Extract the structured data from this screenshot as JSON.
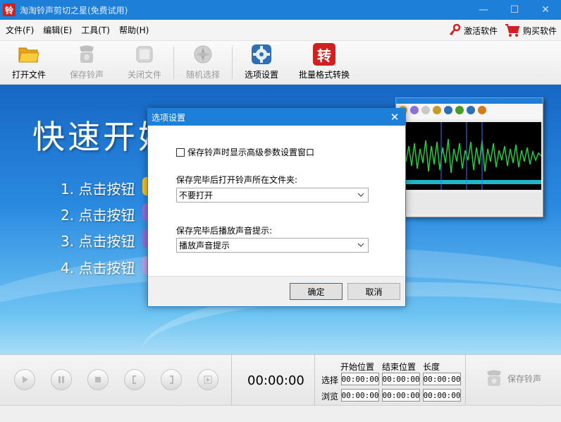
{
  "window": {
    "title": "淘淘铃声剪切之星(免费试用)",
    "app_icon_char": "铃",
    "controls": {
      "minimize": "—",
      "maximize": "☐",
      "close": "✕"
    }
  },
  "menu": {
    "items": [
      "文件(F)",
      "编辑(E)",
      "工具(T)",
      "帮助(H)"
    ],
    "activate": "激活软件",
    "buy": "购买软件"
  },
  "toolbar": {
    "items": [
      {
        "label": "打开文件",
        "icon": "folder-icon",
        "enabled": true
      },
      {
        "label": "保存铃声",
        "icon": "phone-save-icon",
        "enabled": false
      },
      {
        "label": "关闭文件",
        "icon": "close-file-icon",
        "enabled": false
      },
      {
        "label": "随机选择",
        "icon": "random-icon",
        "enabled": false
      },
      {
        "label": "选项设置",
        "icon": "settings-icon",
        "enabled": true
      },
      {
        "label": "批量格式转换",
        "icon": "convert-icon",
        "enabled": true,
        "icon_text": "转"
      }
    ]
  },
  "main": {
    "headline": "快速开始",
    "steps": [
      {
        "num": "1.",
        "text": "点击按钮"
      },
      {
        "num": "2.",
        "text": "点击按钮"
      },
      {
        "num": "3.",
        "text": "点击按钮"
      },
      {
        "num": "4.",
        "text": "点击按钮"
      }
    ]
  },
  "dialog": {
    "title": "选项设置",
    "close": "✕",
    "checkbox_label": "保存铃声时显示高级参数设置窗口",
    "checkbox_checked": false,
    "folder_label": "保存完毕后打开铃声所在文件夹:",
    "folder_value": "不要打开",
    "sound_label": "保存完毕后播放声音提示:",
    "sound_value": "播放声音提示",
    "ok": "确定",
    "cancel": "取消"
  },
  "controls": {
    "time": "00:00:00",
    "headers": [
      "开始位置",
      "结束位置",
      "长度"
    ],
    "row_select": "选择",
    "row_browse": "浏览",
    "select_values": [
      "00:00:00",
      "00:00:00",
      "00:00:00"
    ],
    "browse_values": [
      "00:00:00",
      "00:00:00",
      "00:00:00"
    ],
    "save_label": "保存铃声"
  },
  "colors": {
    "accent": "#1e7fd8",
    "title_bar": "#1e7fd8",
    "buy_red": "#d21f1f"
  }
}
